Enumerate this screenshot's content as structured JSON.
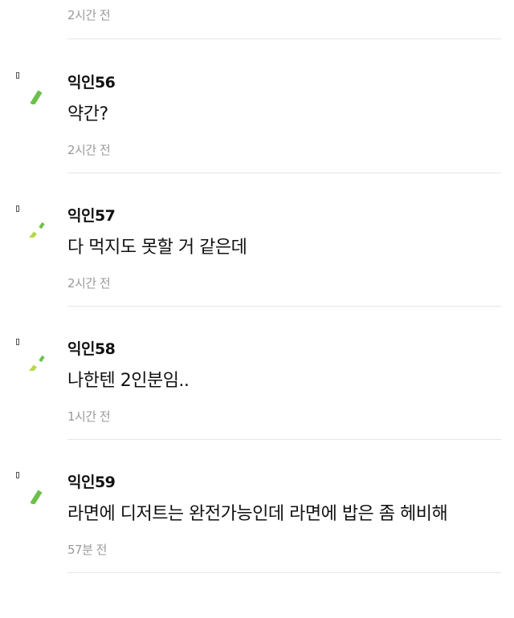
{
  "previous_time": "2시간 전",
  "comments": [
    {
      "nickname": "익인56",
      "text": "약간?",
      "time": "2시간 전"
    },
    {
      "nickname": "익인57",
      "text": "다 먹지도 못할 거 같은데",
      "time": "2시간 전"
    },
    {
      "nickname": "익인58",
      "text": "나한텐 2인분임..",
      "time": "1시간 전"
    },
    {
      "nickname": "익인59",
      "text": "라면에 디저트는 완전가능인데 라면에 밥은 좀 헤비해",
      "time": "57분 전"
    }
  ],
  "colors": {
    "accent_green": "#6cc04a",
    "accent_lime": "#b7d84a",
    "time_gray": "#9a9a9a",
    "divider": "#e6e6e6"
  },
  "icons": [
    "green-stick-icon",
    "lime-dash-icon",
    "lime-dash-icon",
    "green-stick-icon"
  ]
}
